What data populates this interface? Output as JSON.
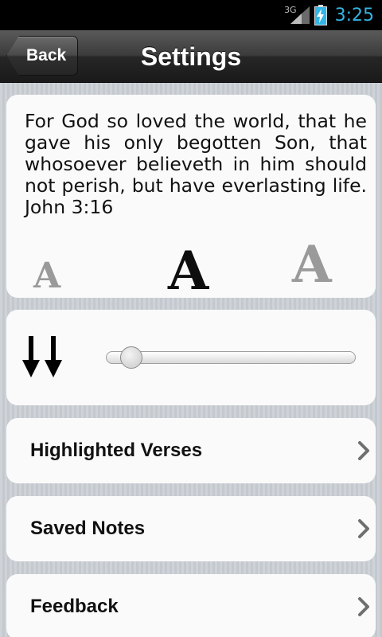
{
  "status_bar": {
    "network": "3G",
    "time": "3:25"
  },
  "header": {
    "title": "Settings",
    "back_label": "Back"
  },
  "verse": {
    "text": "For God so loved the world, that he gave his only begotten Son, that whosoever believeth in him should not perish, but have everlasting life. John 3:16"
  },
  "font_sizes": [
    {
      "glyph": "A",
      "size": "small",
      "selected": false
    },
    {
      "glyph": "A",
      "size": "medium",
      "selected": true
    },
    {
      "glyph": "A",
      "size": "large",
      "selected": false
    }
  ],
  "scroll_speed": {
    "icon": "double-down-arrow-icon",
    "value_fraction": 0.06
  },
  "menu": {
    "highlighted_verses": "Highlighted Verses",
    "saved_notes": "Saved Notes",
    "feedback": "Feedback"
  },
  "colors": {
    "status_bar_bg": "#000000",
    "clock": "#33b5e5",
    "header_bg": "#2e2e2e",
    "page_bg": "#c9cdd2",
    "card_bg": "#fafafa"
  }
}
